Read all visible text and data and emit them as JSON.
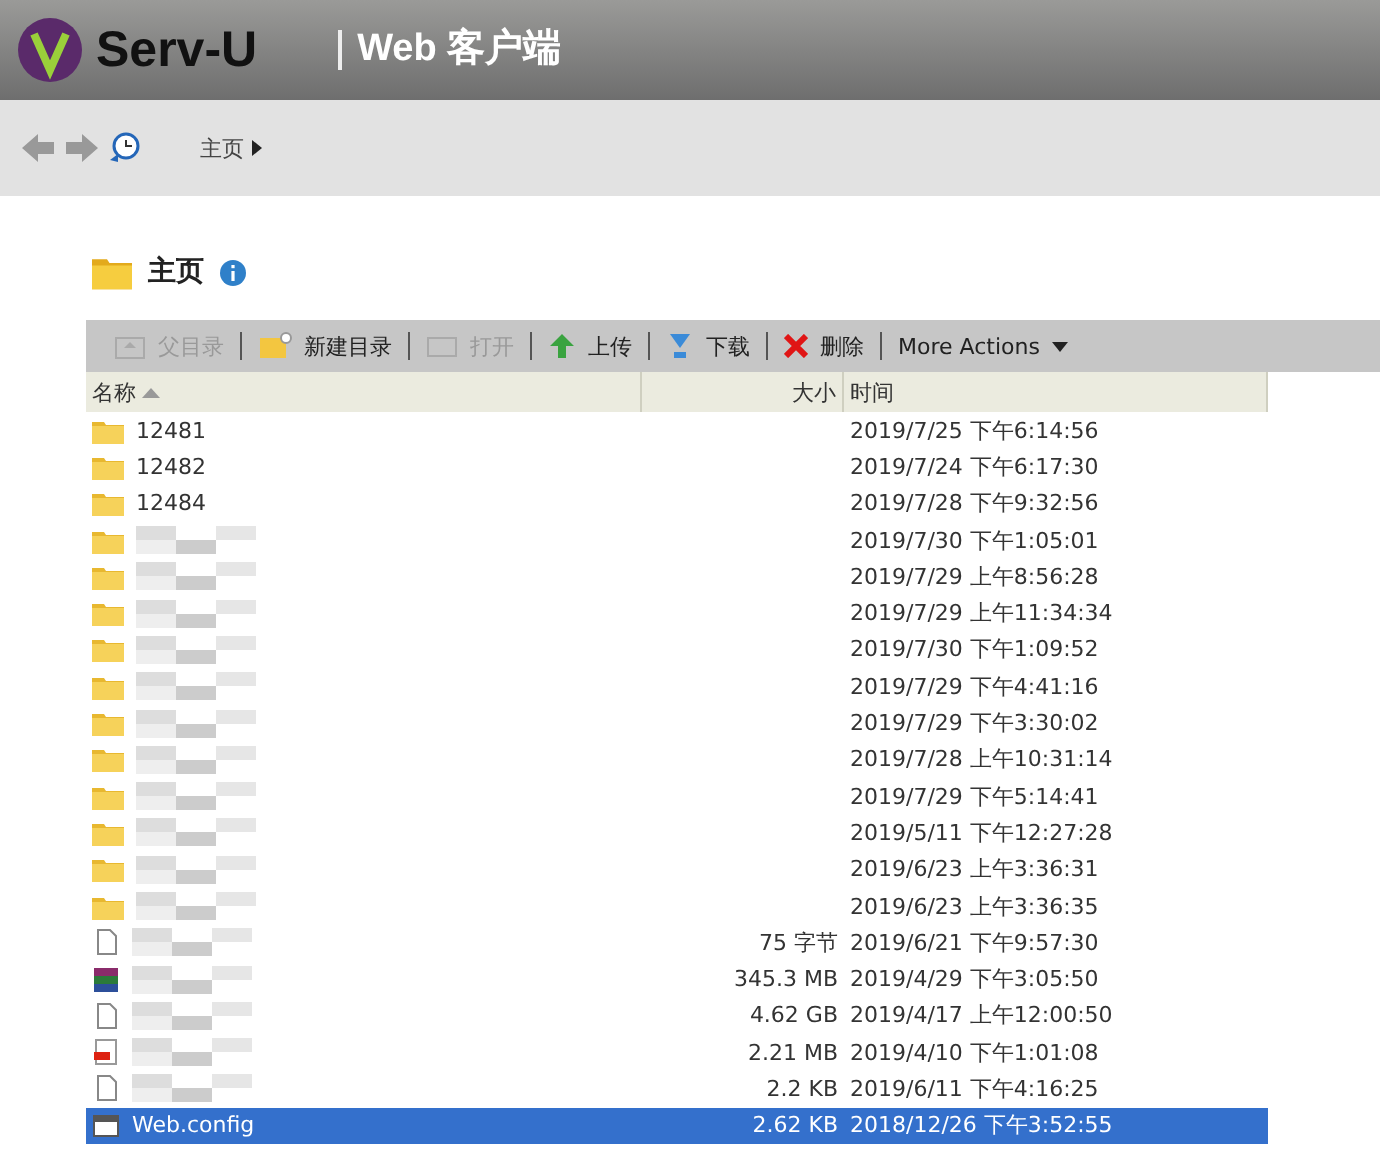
{
  "header": {
    "brand": "Serv-U",
    "subtitle": "Web 客户端"
  },
  "nav": {
    "breadcrumb": "主页"
  },
  "folder": {
    "title": "主页"
  },
  "toolbar": [
    {
      "label": "父目录",
      "disabled": true
    },
    {
      "label": "新建目录",
      "disabled": false
    },
    {
      "label": "打开",
      "disabled": true
    },
    {
      "label": "上传",
      "disabled": false
    },
    {
      "label": "下载",
      "disabled": false
    },
    {
      "label": "删除",
      "disabled": false
    },
    {
      "label": "More Actions",
      "disabled": false
    }
  ],
  "table": {
    "columns": [
      "名称",
      "大小",
      "时间"
    ],
    "rows": [
      {
        "kind": "folder",
        "name": "12481",
        "time": "2019/7/25 下午6:14:56",
        "selected": false
      },
      {
        "kind": "folder",
        "name": "12482",
        "time": "2019/7/24 下午6:17:30",
        "selected": false
      },
      {
        "kind": "folder",
        "name": "12484",
        "time": "2019/7/28 下午9:32:56",
        "selected": false
      },
      {
        "kind": "folder",
        "time": "2019/7/30 下午1:05:01",
        "selected": false
      },
      {
        "kind": "folder",
        "time": "2019/7/29 上午8:56:28",
        "selected": false
      },
      {
        "kind": "folder",
        "time": "2019/7/29 上午11:34:34",
        "selected": false
      },
      {
        "kind": "folder",
        "time": "2019/7/30 下午1:09:52",
        "selected": false
      },
      {
        "kind": "folder",
        "time": "2019/7/29 下午4:41:16",
        "selected": false
      },
      {
        "kind": "folder",
        "time": "2019/7/29 下午3:30:02",
        "selected": false
      },
      {
        "kind": "folder",
        "time": "2019/7/28 上午10:31:14",
        "selected": false
      },
      {
        "kind": "folder",
        "time": "2019/7/29 下午5:14:41",
        "selected": false
      },
      {
        "kind": "folder",
        "time": "2019/5/11 下午12:27:28",
        "selected": false
      },
      {
        "kind": "folder",
        "time": "2019/6/23 上午3:36:31",
        "selected": false
      },
      {
        "kind": "folder",
        "time": "2019/6/23 上午3:36:35",
        "selected": false
      },
      {
        "kind": "file",
        "size": "75 字节",
        "time": "2019/6/21 下午9:57:30",
        "selected": false
      },
      {
        "kind": "archive",
        "size": "345.3 MB",
        "time": "2019/4/29 下午3:05:50",
        "selected": false
      },
      {
        "kind": "file",
        "size": "4.62 GB",
        "time": "2019/4/17 上午12:00:50",
        "selected": false
      },
      {
        "kind": "pdf",
        "size": "2.21 MB",
        "time": "2019/4/10 下午1:01:08",
        "selected": false
      },
      {
        "kind": "file",
        "size": "2.2 KB",
        "time": "2019/6/11 下午4:16:25",
        "selected": false
      },
      {
        "kind": "config",
        "name": "Web.config",
        "size": "2.62 KB",
        "time": "2018/12/26 下午3:52:55",
        "selected": true
      }
    ]
  }
}
